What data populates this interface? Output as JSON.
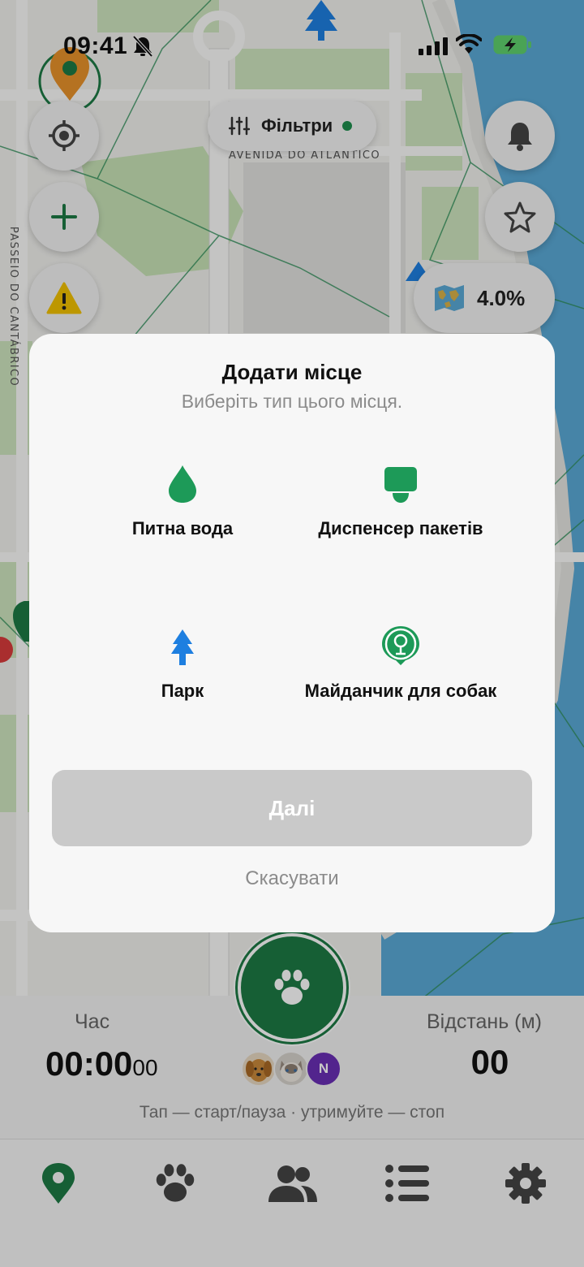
{
  "status_bar": {
    "time": "09:41"
  },
  "map": {
    "filters_label": "Фільтри",
    "street_1": "AVENIDA DO ATLÂNTICO",
    "street_2": "PASSEIO DO CANTÁBRICO",
    "exploration_percent": "4.0%"
  },
  "modal": {
    "title": "Додати місце",
    "subtitle": "Виберіть тип цього місця.",
    "options": [
      {
        "label": "Питна вода",
        "icon": "water-drop-icon"
      },
      {
        "label": "Диспенсер пакетів",
        "icon": "bag-dispenser-icon"
      },
      {
        "label": "Парк",
        "icon": "tree-icon"
      },
      {
        "label": "Майданчик для собак",
        "icon": "dog-park-icon"
      }
    ],
    "next_label": "Далі",
    "cancel_label": "Скасувати"
  },
  "tracker": {
    "time_label": "Час",
    "time_value": "00:00",
    "time_fraction": "00",
    "distance_label": "Відстань (м)",
    "distance_value": "00",
    "hint": "Тап — старт/пауза · утримуйте — стоп",
    "avatar_initial": "N"
  },
  "tabs": [
    {
      "icon": "map-pin-icon",
      "active": true
    },
    {
      "icon": "paw-icon",
      "active": false
    },
    {
      "icon": "people-icon",
      "active": false
    },
    {
      "icon": "list-icon",
      "active": false
    },
    {
      "icon": "gear-icon",
      "active": false
    }
  ],
  "colors": {
    "accent": "#1d7a45",
    "park_blue": "#1e7fe0",
    "water": "#5aa9d6",
    "disabled": "#c9c9c9"
  }
}
